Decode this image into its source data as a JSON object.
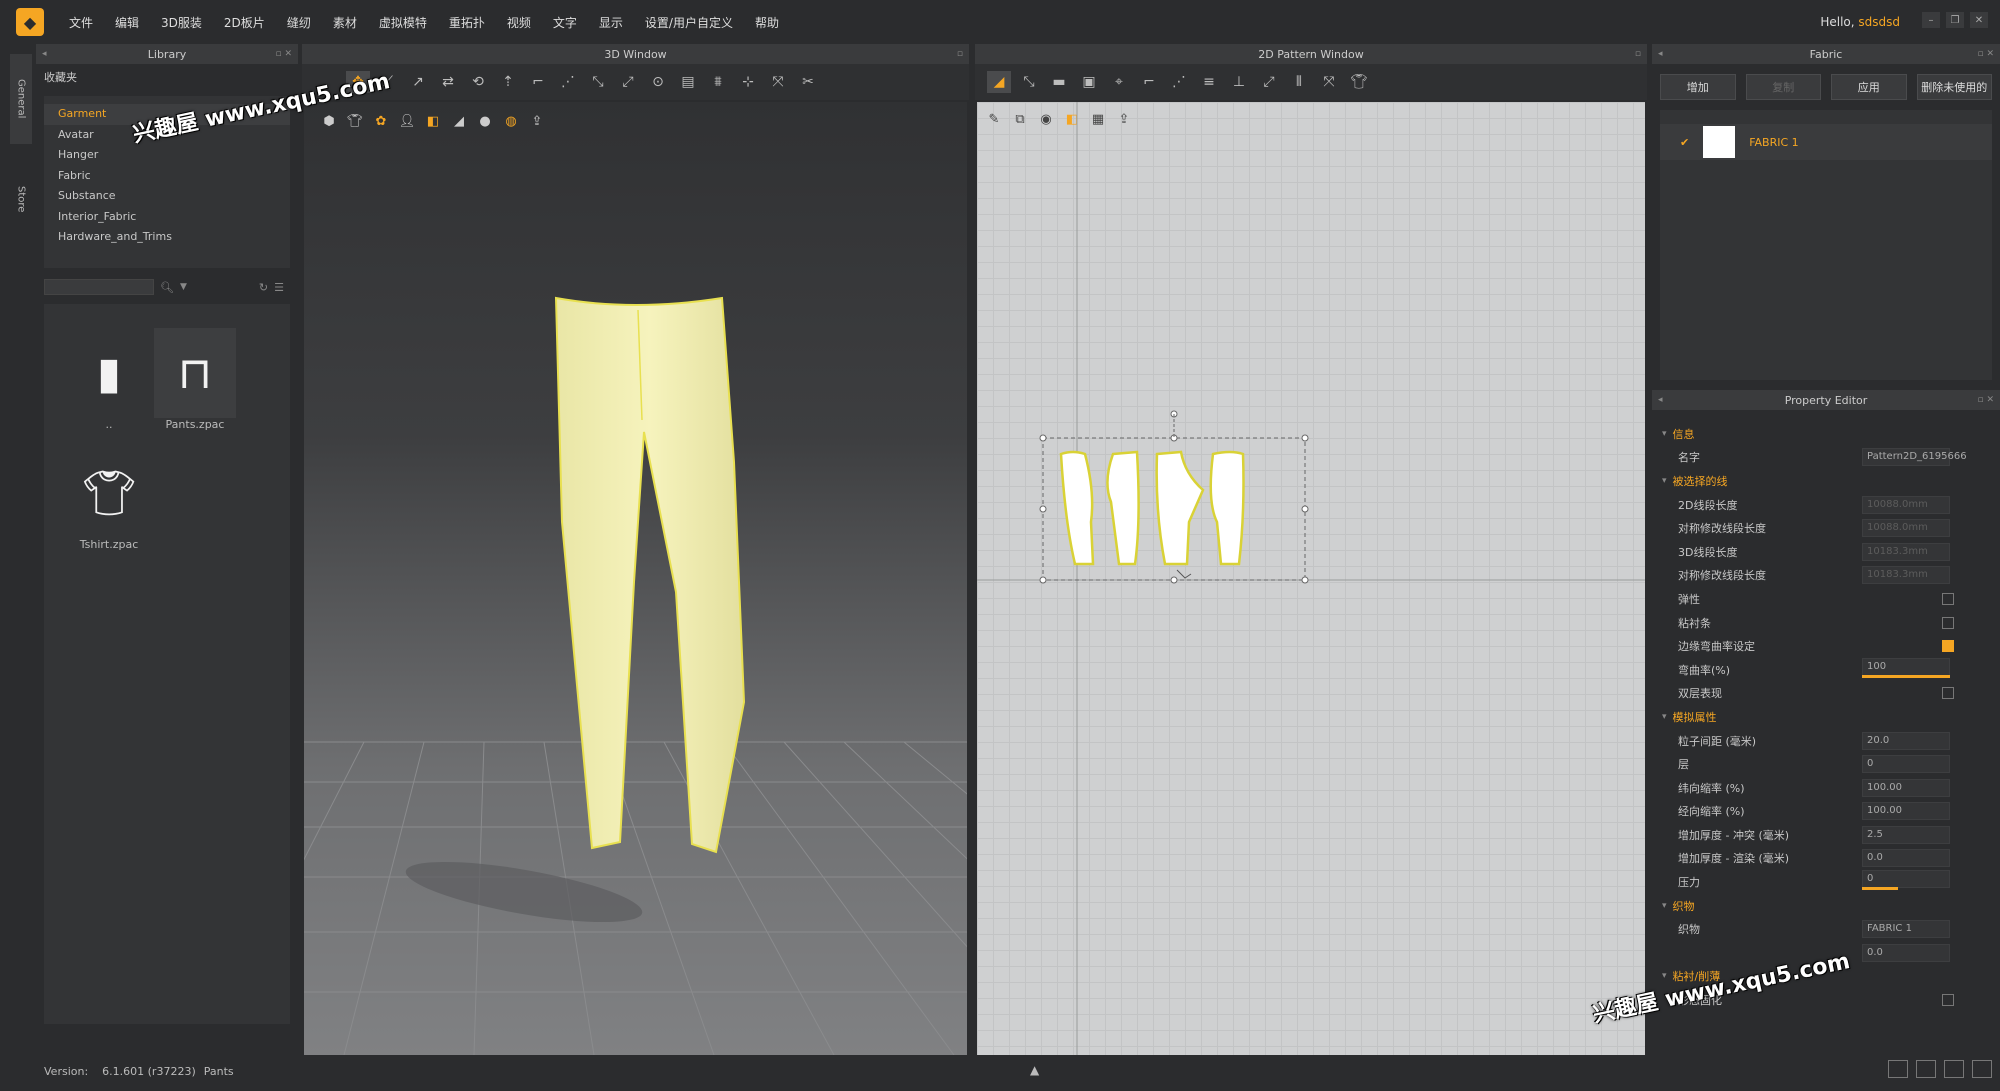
{
  "menubar": {
    "items": [
      "文件",
      "编辑",
      "3D服装",
      "2D板片",
      "缝纫",
      "素材",
      "虚拟模特",
      "重拓扑",
      "视频",
      "文字",
      "显示",
      "设置/用户自定义",
      "帮助"
    ],
    "hello": "Hello,",
    "user": "sdsdsd"
  },
  "sidetabs": [
    "General",
    "Store"
  ],
  "library": {
    "title": "Library",
    "favorites": "收藏夹",
    "tree": [
      "Garment",
      "Avatar",
      "Hanger",
      "Fabric",
      "Substance",
      "Interior_Fabric",
      "Hardware_and_Trims"
    ],
    "files": [
      {
        "name": "..",
        "icon": "folder-icon"
      },
      {
        "name": "Pants.zpac",
        "icon": "pants-icon"
      },
      {
        "name": "Tshirt.zpac",
        "icon": "tshirt-icon"
      }
    ]
  },
  "window3d": {
    "title": "3D Window"
  },
  "window2d": {
    "title": "2D Pattern Window"
  },
  "fabric": {
    "title": "Fabric",
    "buttons": [
      "增加",
      "复制",
      "应用",
      "删除未使用的"
    ],
    "items": [
      {
        "name": "FABRIC 1"
      }
    ]
  },
  "property": {
    "title": "Property Editor",
    "rows": [
      {
        "type": "sec",
        "label": "信息"
      },
      {
        "type": "val",
        "label": "名字",
        "value": "Pattern2D_6195666"
      },
      {
        "type": "sec",
        "label": "被选择的线"
      },
      {
        "type": "dim",
        "label": "2D线段长度",
        "value": "10088.0mm"
      },
      {
        "type": "dim",
        "label": "对称修改线段长度",
        "value": "10088.0mm"
      },
      {
        "type": "dim",
        "label": "3D线段长度",
        "value": "10183.3mm"
      },
      {
        "type": "dim",
        "label": "对称修改线段长度",
        "value": "10183.3mm"
      },
      {
        "type": "cb",
        "label": "弹性",
        "checked": false
      },
      {
        "type": "cb",
        "label": "粘衬条",
        "checked": false
      },
      {
        "type": "cb",
        "label": "边缘弯曲率设定",
        "checked": true
      },
      {
        "type": "slider",
        "label": "弯曲率(%)",
        "value": "100"
      },
      {
        "type": "cb",
        "label": "双层表现",
        "checked": false
      },
      {
        "type": "sec",
        "label": "模拟属性"
      },
      {
        "type": "val",
        "label": "粒子间距 (毫米)",
        "value": "20.0"
      },
      {
        "type": "val",
        "label": "层",
        "value": "0"
      },
      {
        "type": "val",
        "label": "纬向缩率 (%)",
        "value": "100.00"
      },
      {
        "type": "val",
        "label": "经向缩率 (%)",
        "value": "100.00"
      },
      {
        "type": "val",
        "label": "增加厚度 - 冲突 (毫米)",
        "value": "2.5"
      },
      {
        "type": "val",
        "label": "增加厚度 - 渲染 (毫米)",
        "value": "0.0"
      },
      {
        "type": "slider",
        "label": "压力",
        "value": "0"
      },
      {
        "type": "sec",
        "label": "织物"
      },
      {
        "type": "val",
        "label": "织物",
        "value": "FABRIC 1"
      },
      {
        "type": "val",
        "label": "",
        "value": "0.0"
      },
      {
        "type": "sec",
        "label": "粘衬/削薄"
      },
      {
        "type": "cb",
        "label": "形态固化",
        "checked": false
      }
    ]
  },
  "status": {
    "version_label": "Version:",
    "version": "6.1.601 (r37223)",
    "file": "Pants"
  },
  "watermarks": [
    "兴趣屋 www.xqu5.com",
    "兴趣屋 www.xqu5.com"
  ],
  "colors": {
    "accent": "#f5a623",
    "garment": "#f2f0b0",
    "garment_edge": "#e8e050"
  }
}
